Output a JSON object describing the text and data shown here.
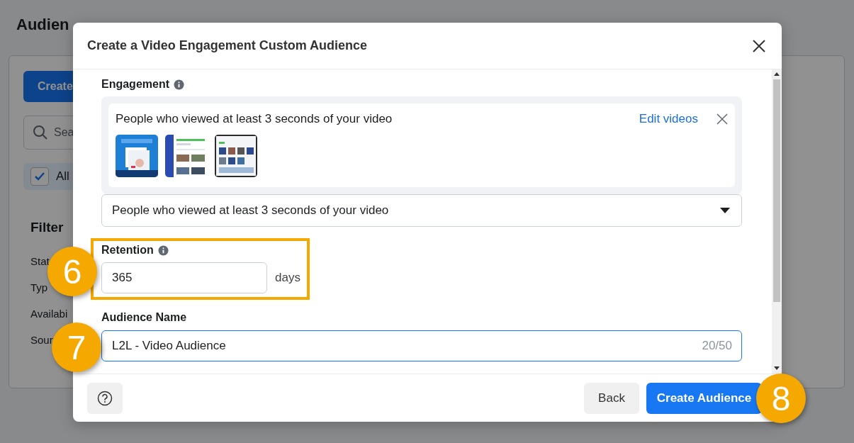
{
  "background_page": {
    "title": "Audien",
    "create_button": "Create",
    "search": {
      "placeholder": "Sea"
    },
    "all_filter": {
      "label": "All",
      "checked": true
    },
    "filter_heading": "Filter",
    "filter_items": [
      "Stat",
      "Typ",
      "Availabi",
      "Sour"
    ]
  },
  "dialog": {
    "title": "Create a Video Engagement Custom Audience",
    "engagement": {
      "label": "Engagement",
      "summary": "People who viewed at least 3 seconds of your video",
      "edit_link": "Edit videos",
      "dropdown": {
        "value": "People who viewed at least 3 seconds of your video"
      }
    },
    "retention": {
      "label": "Retention",
      "value": "365",
      "unit": "days",
      "highlighted": true
    },
    "audience_name": {
      "label": "Audience Name",
      "value": "L2L - Video Audience",
      "counter": "20/50",
      "focused": true
    },
    "buttons": [
      {
        "label": "Back",
        "kind": "secondary"
      },
      {
        "label": "Create Audience",
        "kind": "primary"
      }
    ]
  },
  "callouts": [
    {
      "number": "6"
    },
    {
      "number": "7"
    },
    {
      "number": "8"
    }
  ]
}
